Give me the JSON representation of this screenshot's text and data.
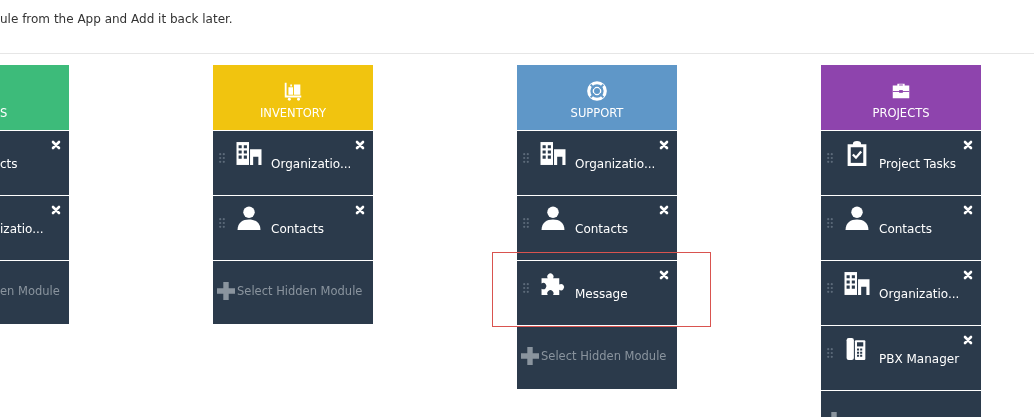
{
  "intro": "ule from the App and Add it back later.",
  "columns": [
    {
      "kind": "clipped",
      "title": "S",
      "color": "#3dbb7a",
      "items": [
        {
          "kind": "contacts",
          "label": "cts",
          "highlighted": false
        },
        {
          "kind": "organizations",
          "label": "izatio...",
          "highlighted": false
        }
      ],
      "add_label": "en Module"
    },
    {
      "kind": "inventory",
      "title": "INVENTORY",
      "color": "#f1c40f",
      "items": [
        {
          "kind": "organizations",
          "label": "Organizatio...",
          "highlighted": false
        },
        {
          "kind": "contacts",
          "label": "Contacts",
          "highlighted": false
        }
      ],
      "add_label": "Select Hidden Module"
    },
    {
      "kind": "support",
      "title": "SUPPORT",
      "color": "#5f97c8",
      "items": [
        {
          "kind": "organizations",
          "label": "Organizatio...",
          "highlighted": false
        },
        {
          "kind": "contacts",
          "label": "Contacts",
          "highlighted": false
        },
        {
          "kind": "message",
          "label": "Message",
          "highlighted": true
        }
      ],
      "add_label": "Select Hidden Module"
    },
    {
      "kind": "projects",
      "title": "PROJECTS",
      "color": "#8e44ad",
      "items": [
        {
          "kind": "tasks",
          "label": "Project Tasks",
          "highlighted": false
        },
        {
          "kind": "contacts",
          "label": "Contacts",
          "highlighted": false
        },
        {
          "kind": "organizations",
          "label": "Organizatio...",
          "highlighted": false
        },
        {
          "kind": "pbx",
          "label": "PBX Manager",
          "highlighted": false
        }
      ]
    }
  ]
}
